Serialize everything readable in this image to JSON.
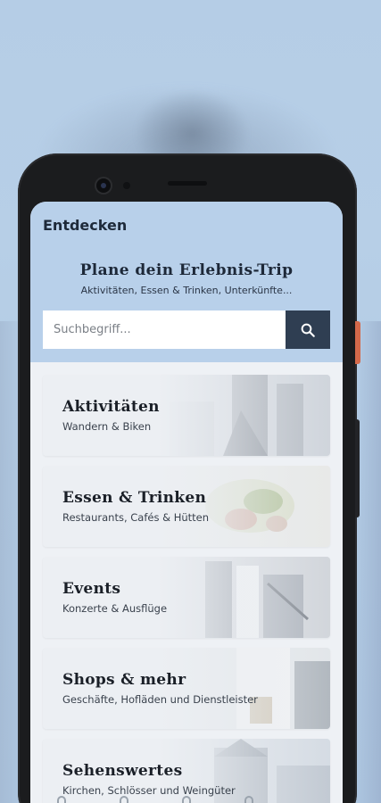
{
  "appbar": {
    "title": "Entdecken"
  },
  "hero": {
    "title": "Plane dein Erlebnis-Trip",
    "subtitle": "Aktivitäten, Essen & Trinken, Unterkünfte..."
  },
  "search": {
    "placeholder": "Suchbegriff...",
    "button_icon": "search-icon"
  },
  "categories": [
    {
      "title": "Aktivitäten",
      "subtitle": "Wandern & Biken"
    },
    {
      "title": "Essen & Trinken",
      "subtitle": "Restaurants, Cafés & Hütten"
    },
    {
      "title": "Events",
      "subtitle": "Konzerte & Ausflüge"
    },
    {
      "title": "Shops & mehr",
      "subtitle": "Geschäfte, Hofläden und Dienstleister"
    },
    {
      "title": "Sehenswertes",
      "subtitle": "Kirchen, Schlösser und Weingüter"
    }
  ],
  "colors": {
    "background": "#b5cde6",
    "hero": "#b8d0ea",
    "search_button": "#2f3e52",
    "accent_button": "#d4694a"
  }
}
